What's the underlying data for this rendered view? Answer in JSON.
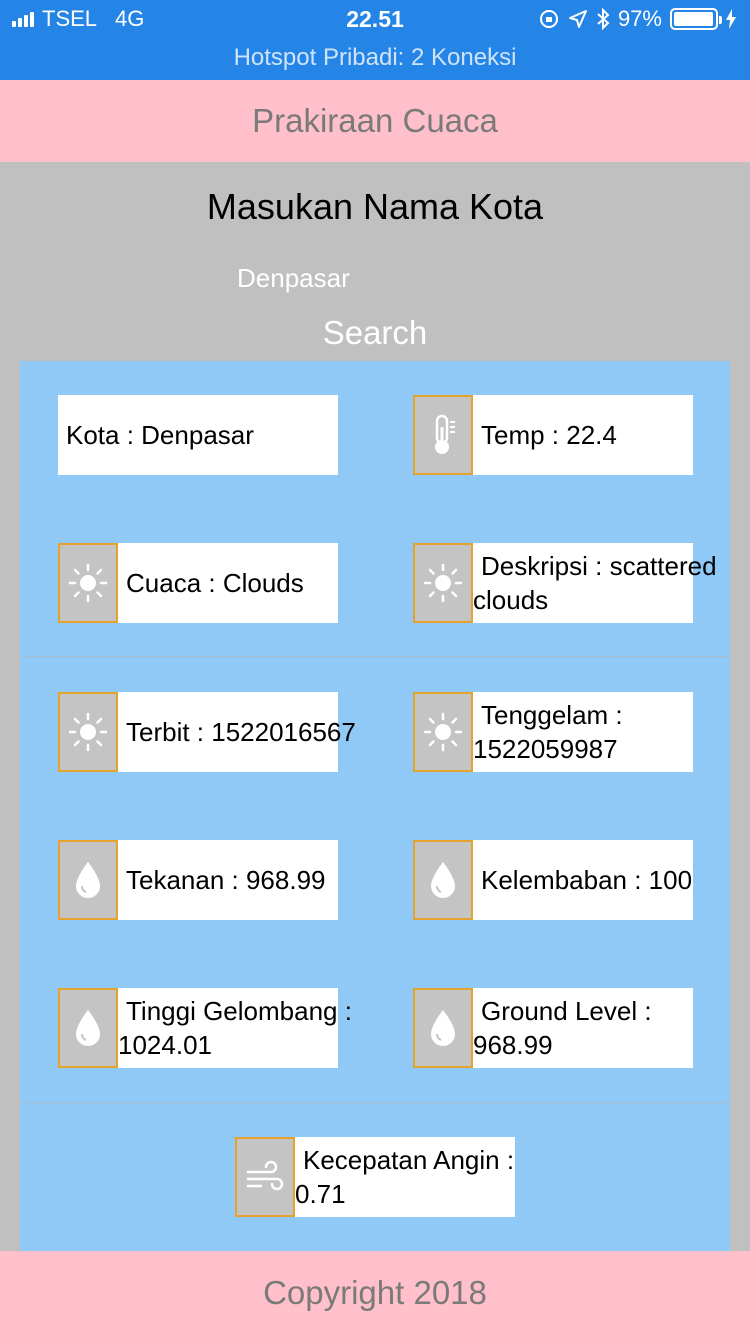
{
  "status_bar": {
    "carrier": "TSEL",
    "network": "4G",
    "time": "22.51",
    "battery": "97%",
    "battery_level": 0.97,
    "hotspot": "Hotspot Pribadi: 2 Koneksi"
  },
  "header": {
    "title": "Prakiraan Cuaca"
  },
  "form": {
    "prompt": "Masukan Nama Kota",
    "city_value": "Denpasar",
    "search_label": "Search"
  },
  "weather": {
    "kota": "Kota : Denpasar",
    "temp": "Temp : 22.4",
    "cuaca": "Cuaca : Clouds",
    "deskripsi_1": "Deskripsi : scattered",
    "deskripsi_2": "clouds",
    "terbit": "Terbit : 1522016567",
    "tenggelam_1": "Tenggelam :",
    "tenggelam_2": "1522059987",
    "tekanan": "Tekanan : 968.99",
    "kelembaban": "Kelembaban : 100",
    "tinggi_1": "Tinggi Gelombang :",
    "tinggi_2": "1024.01",
    "ground_1": "Ground Level :",
    "ground_2": "968.99",
    "angin_1": "Kecepatan Angin :",
    "angin_2": "0.71"
  },
  "icons": {
    "temp": "thermometer-icon",
    "sun": "sun-icon",
    "drop": "water-drop-icon",
    "wind": "wind-icon"
  },
  "colors": {
    "status_bar": "#2485e6",
    "header": "#ffc0cb",
    "panel": "#90c9f6",
    "icon_border": "#e5a32b"
  },
  "footer": {
    "text": "Copyright 2018"
  }
}
